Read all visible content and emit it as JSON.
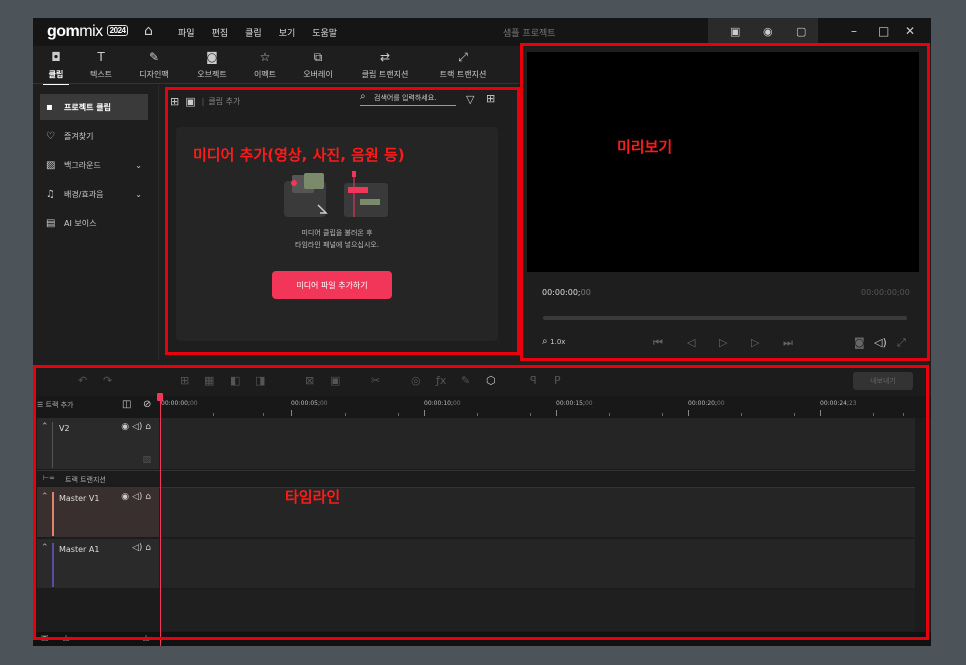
{
  "app": {
    "logo_main": "gom",
    "logo_mix": "mix",
    "logo_year": "2024",
    "document_title": "샘플 프로젝트"
  },
  "menu": [
    "파일",
    "편집",
    "클립",
    "보기",
    "도움말"
  ],
  "toolbar": {
    "tabs": [
      {
        "icon": "media-icon",
        "label": "클립"
      },
      {
        "icon": "text-icon",
        "label": "텍스트"
      },
      {
        "icon": "design-icon",
        "label": "디자인팩"
      },
      {
        "icon": "object-icon",
        "label": "오브젝트"
      },
      {
        "icon": "effect-icon",
        "label": "이펙트"
      },
      {
        "icon": "overlay-icon",
        "label": "오버레이"
      },
      {
        "icon": "clip-transition-icon",
        "label": "클립 트랜지션"
      },
      {
        "icon": "track-transition-icon",
        "label": "트랙 트랜지션"
      }
    ],
    "active_tab": "클립"
  },
  "sidebar": {
    "items": [
      {
        "label": "프로젝트 클립",
        "icon": "folder-icon",
        "active": true
      },
      {
        "label": "즐겨찾기",
        "icon": "heart-icon"
      },
      {
        "label": "백그라운드",
        "icon": "pattern-icon",
        "expandable": true
      },
      {
        "label": "배경/효과음",
        "icon": "music-icon",
        "expandable": true
      },
      {
        "label": "AI 보이스",
        "icon": "ai-icon"
      }
    ]
  },
  "media": {
    "add_clip_label": "클립 추가",
    "search_placeholder": "검색어를 입력하세요.",
    "drop_text_line1": "미디어 클립을 불러온 후",
    "drop_text_line2": "타임라인 패널에 넣으십시오.",
    "add_button": "미디어 파일 추가하기"
  },
  "annotations": {
    "media": "미디어 추가(영상, 사진, 음원 등)",
    "preview": "미리보기",
    "timeline": "타임라인"
  },
  "preview": {
    "current_time_main": "00:00:00;",
    "current_time_frac": "00",
    "total_time": "00:00:00;00",
    "zoom": "1.0x"
  },
  "timeline": {
    "add_track_label": "트랙 추가",
    "export_label": "내보내기",
    "ruler_ticks": [
      {
        "main": "00:00:00;",
        "frac": "00"
      },
      {
        "main": "00:00:05;",
        "frac": "00"
      },
      {
        "main": "00:00:10;",
        "frac": "00"
      },
      {
        "main": "00:00:15;",
        "frac": "00"
      },
      {
        "main": "00:00:20;",
        "frac": "00"
      },
      {
        "main": "00:00:24;",
        "frac": "23"
      }
    ],
    "tracks": [
      {
        "name": "V2"
      },
      {
        "name": "트랙 트랜지션"
      },
      {
        "name": "Master V1"
      },
      {
        "name": "Master A1"
      }
    ]
  },
  "colors": {
    "accent": "#f2365a",
    "annotation": "#e8000c"
  }
}
